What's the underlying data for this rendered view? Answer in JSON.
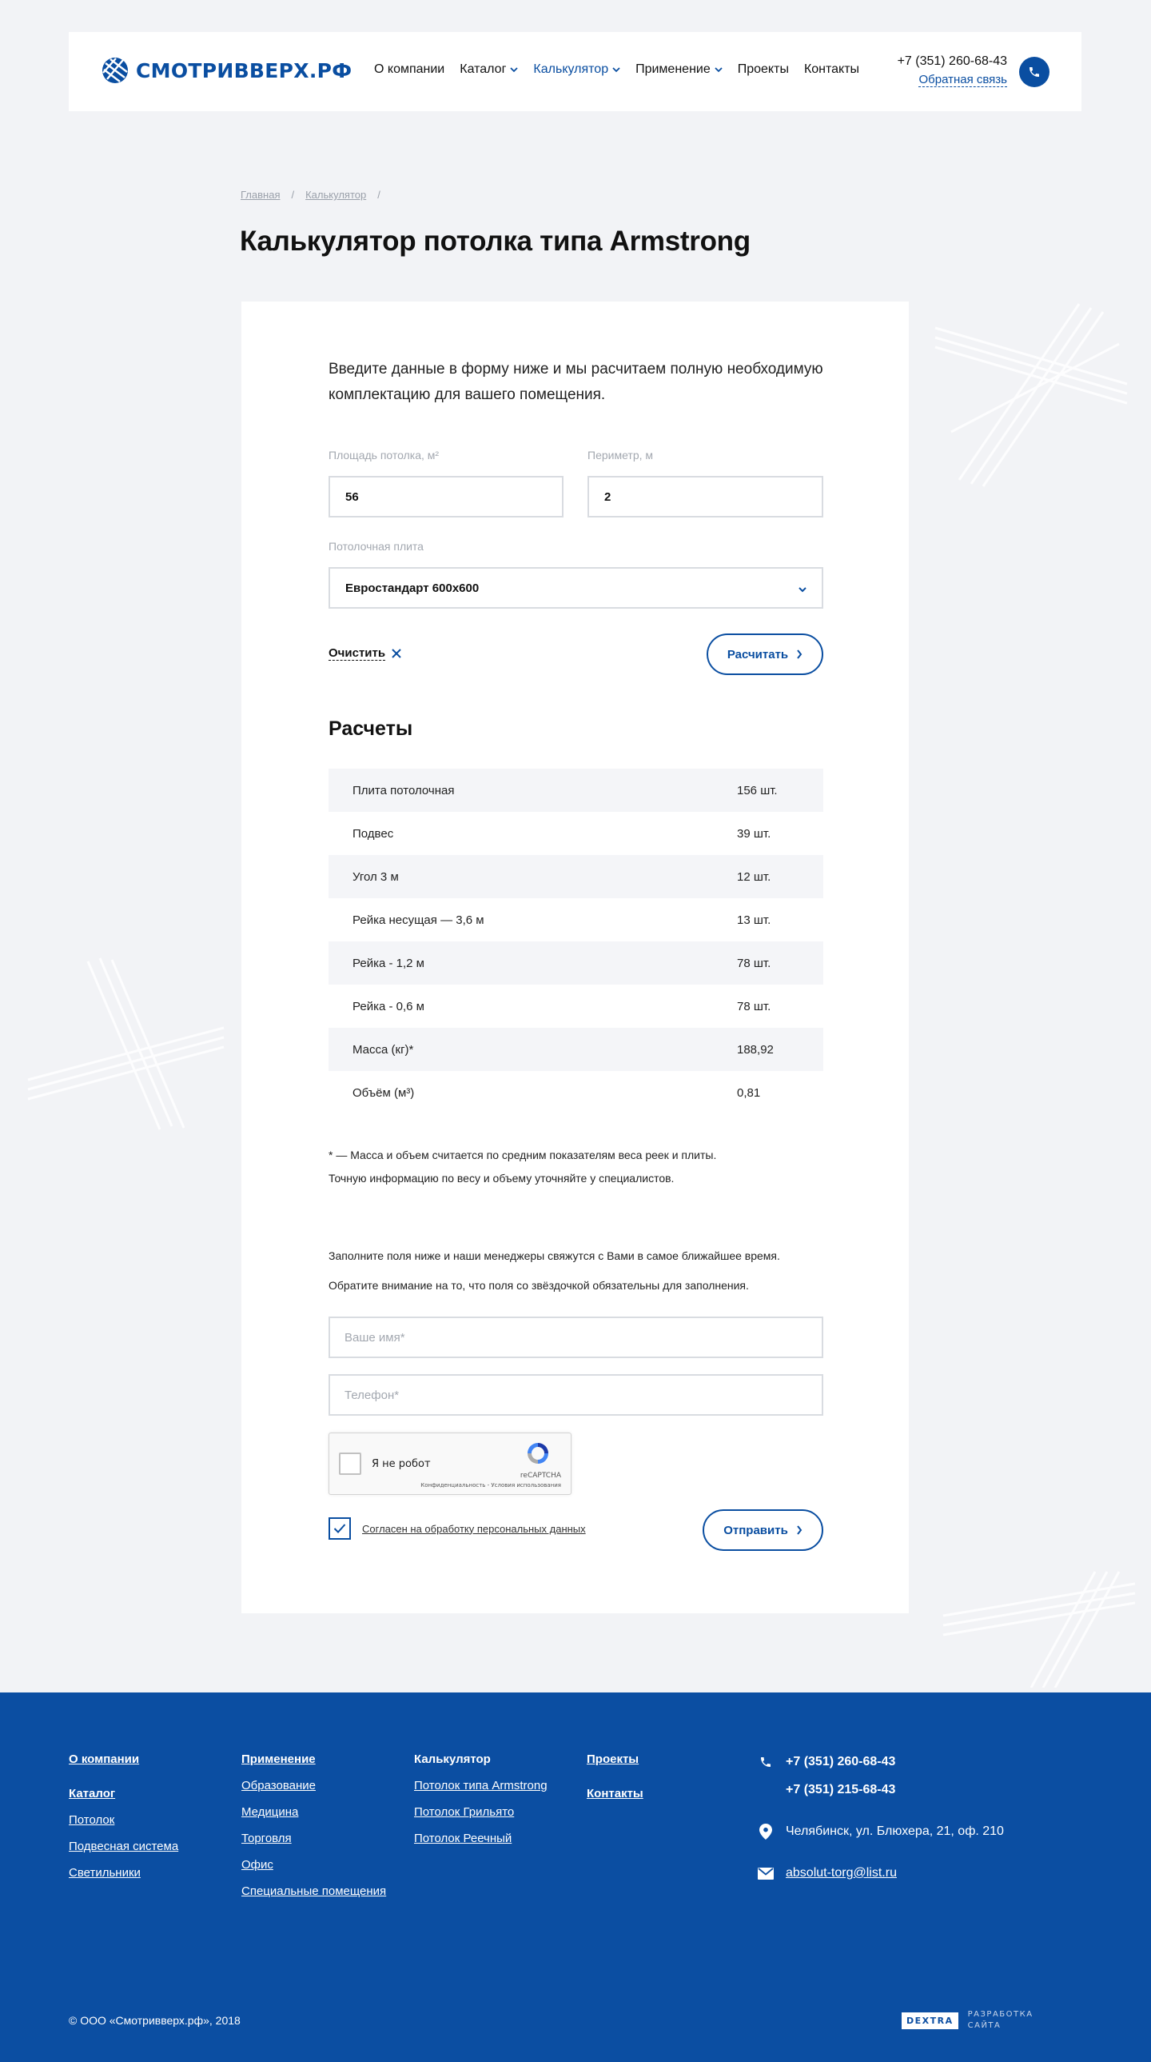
{
  "header": {
    "logo_text": "СМОТРИВВЕРХ.РФ",
    "nav": [
      {
        "label": "О компании",
        "dropdown": false,
        "active": false
      },
      {
        "label": "Каталог",
        "dropdown": true,
        "active": false
      },
      {
        "label": "Калькулятор",
        "dropdown": true,
        "active": true
      },
      {
        "label": "Применение",
        "dropdown": true,
        "active": false
      },
      {
        "label": "Проекты",
        "dropdown": false,
        "active": false
      },
      {
        "label": "Контакты",
        "dropdown": false,
        "active": false
      }
    ],
    "phone": "+7 (351) 260-68-43",
    "feedback_label": "Обратная связь"
  },
  "breadcrumb": {
    "items": [
      "Главная",
      "Калькулятор"
    ],
    "separator": "/"
  },
  "page_title": "Калькулятор потолка типа Armstrong",
  "calculator": {
    "intro": "Введите данные в форму ниже и мы расчитаем полную необходимую комплектацию для вашего помещения.",
    "area_label": "Площадь потолка, м²",
    "area_value": "56",
    "perimeter_label": "Периметр, м",
    "perimeter_value": "2",
    "tile_label": "Потолочная плита",
    "tile_value": "Евростандарт 600х600",
    "clear_label": "Очистить",
    "calc_label": "Расчитать"
  },
  "results": {
    "title": "Расчеты",
    "rows": [
      {
        "name": "Плита потолочная",
        "value": "156 шт."
      },
      {
        "name": "Подвес",
        "value": "39 шт."
      },
      {
        "name": "Угол 3 м",
        "value": "12 шт."
      },
      {
        "name": "Рейка несущая — 3,6 м",
        "value": "13 шт."
      },
      {
        "name": "Рейка - 1,2 м",
        "value": "78 шт."
      },
      {
        "name": "Рейка - 0,6 м",
        "value": "78 шт."
      },
      {
        "name": "Масса (кг)*",
        "value": "188,92"
      },
      {
        "name": "Объём (м³)",
        "value": "0,81"
      }
    ],
    "footnote_line1": "* — Масса и объем считается по средним показателям веса реек и плиты.",
    "footnote_line2": "Точную информацию по весу и объему уточняйте у специалистов."
  },
  "contact_form": {
    "note_line1": "Заполните поля ниже и наши менеджеры свяжутся с Вами в самое ближайшее время.",
    "note_line2": "Обратите внимание на то, что поля со звёздочкой обязательны для заполнения.",
    "name_placeholder": "Ваше имя*",
    "phone_placeholder": "Телефон*",
    "captcha_label": "Я не робот",
    "captcha_brand": "reCAPTCHA",
    "captcha_terms": "Конфиденциальность - Условия использования",
    "consent_label": "Согласен на обработку персональных данных",
    "consent_checked": true,
    "submit_label": "Отправить"
  },
  "footer": {
    "col1": {
      "head1": "О компании",
      "head2": "Каталог",
      "links": [
        "Потолок",
        "Подвесная система",
        "Светильники"
      ]
    },
    "col2": {
      "head": "Применение",
      "links": [
        "Образование",
        "Медицина",
        "Торговля",
        "Офис",
        "Специальные помещения"
      ]
    },
    "col3": {
      "head": "Калькулятор",
      "links": [
        "Потолок типа Armstrong",
        "Потолок Грильято",
        "Потолок Реечный"
      ]
    },
    "col4": {
      "head1": "Проекты",
      "head2": "Контакты"
    },
    "phone1": "+7 (351) 260-68-43",
    "phone2": "+7 (351) 215-68-43",
    "address": "Челябинск, ул. Блюхера, 21, оф. 210",
    "email": "absolut-torg@list.ru",
    "copyright": "© ООО «Смотривверх.рф», 2018",
    "dev_badge": "DEXTRA",
    "dev_text": "РАЗРАБОТКА САЙТА"
  },
  "colors": {
    "brand": "#0a4ea1",
    "footer_bg": "#0b4ea2",
    "page_bg": "#f2f3f6"
  }
}
